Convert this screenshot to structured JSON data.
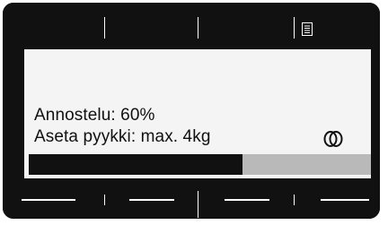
{
  "display": {
    "dosing_label": "Annostelu: 60%",
    "load_label": "Aseta pyykki: max. 4kg",
    "progress_fraction": 0.625
  },
  "icons": {
    "top_right": "document-icon",
    "status": "drum-icon"
  },
  "colors": {
    "frame": "#111111",
    "screen": "#f4f4f4",
    "progress_fill": "#111111",
    "progress_track": "#b9b9b9"
  }
}
